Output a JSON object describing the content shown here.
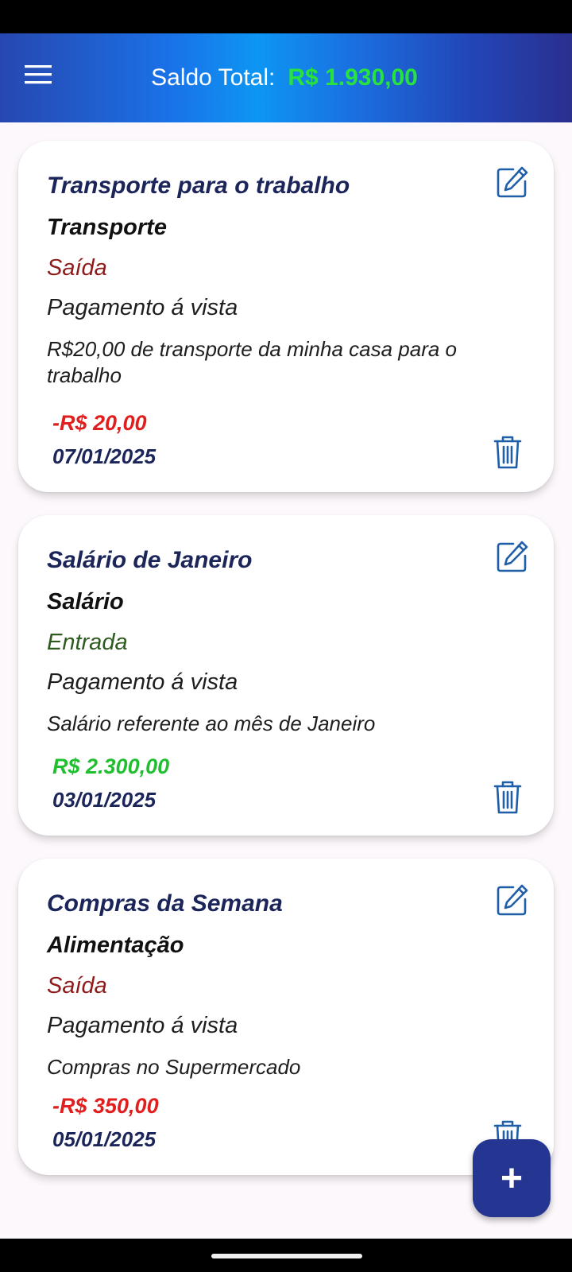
{
  "header": {
    "balance_label": "Saldo Total:",
    "balance_value": "R$ 1.930,00",
    "balance_color": "#27e23f"
  },
  "icons": {
    "menu": "menu-icon",
    "edit": "edit-icon",
    "delete": "trash-icon",
    "add": "plus-icon"
  },
  "transactions": [
    {
      "title": "Transporte para o trabalho",
      "category": "Transporte",
      "type": "Saída",
      "payment": "Pagamento á vista",
      "description": "R$20,00 de transporte da minha casa para o trabalho",
      "amount": "-R$ 20,00",
      "date": "07/01/2025"
    },
    {
      "title": "Salário de Janeiro",
      "category": "Salário",
      "type": "Entrada",
      "payment": "Pagamento á vista",
      "description": "Salário referente ao mês de Janeiro",
      "amount": "R$ 2.300,00",
      "date": "03/01/2025"
    },
    {
      "title": "Compras da Semana",
      "category": "Alimentação",
      "type": "Saída",
      "payment": "Pagamento á vista",
      "description": "Compras no Supermercado",
      "amount": "-R$ 350,00",
      "date": "05/01/2025"
    }
  ],
  "fab": {
    "label": "+"
  },
  "colors": {
    "expense": "#e11d1d",
    "income": "#1fbf2f",
    "fab": "#253692",
    "title": "#1b2559"
  }
}
